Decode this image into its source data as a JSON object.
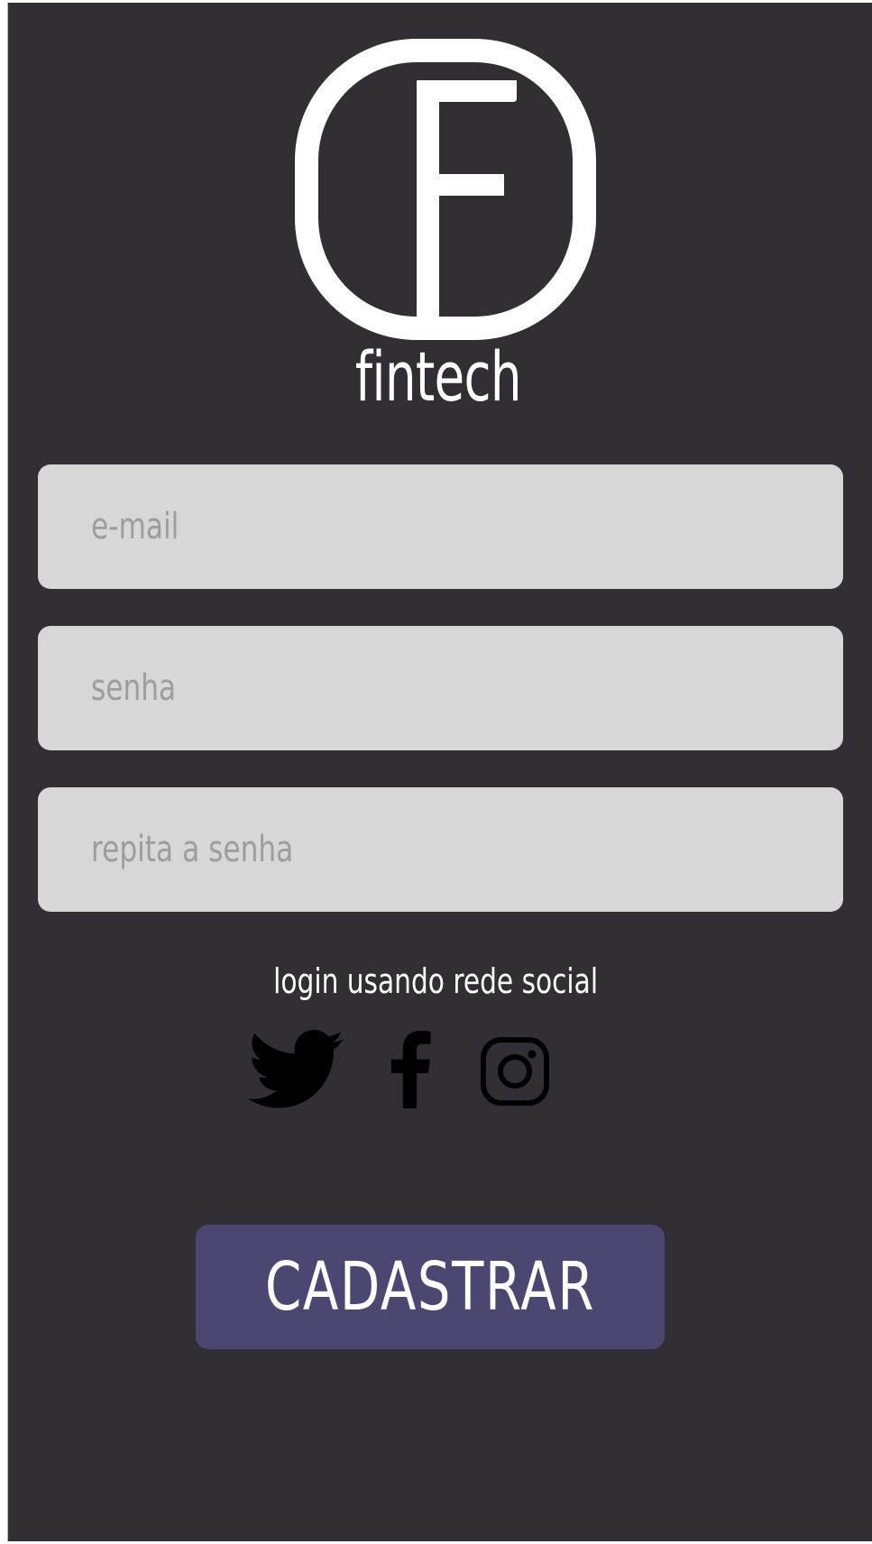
{
  "brand": {
    "name": "fintech",
    "logo_letter": "F"
  },
  "form": {
    "email_placeholder": "e-mail",
    "password_placeholder": "senha",
    "repeat_password_placeholder": "repita a senha"
  },
  "social": {
    "caption": "login usando rede social",
    "icons": [
      "twitter-icon",
      "facebook-icon",
      "instagram-icon"
    ]
  },
  "actions": {
    "submit_label": "CADASTRAR"
  },
  "colors": {
    "background": "#312f34",
    "field": "#d7d7d7",
    "placeholder": "#9d9d9d",
    "button": "#4a4870",
    "text": "#ffffff"
  }
}
